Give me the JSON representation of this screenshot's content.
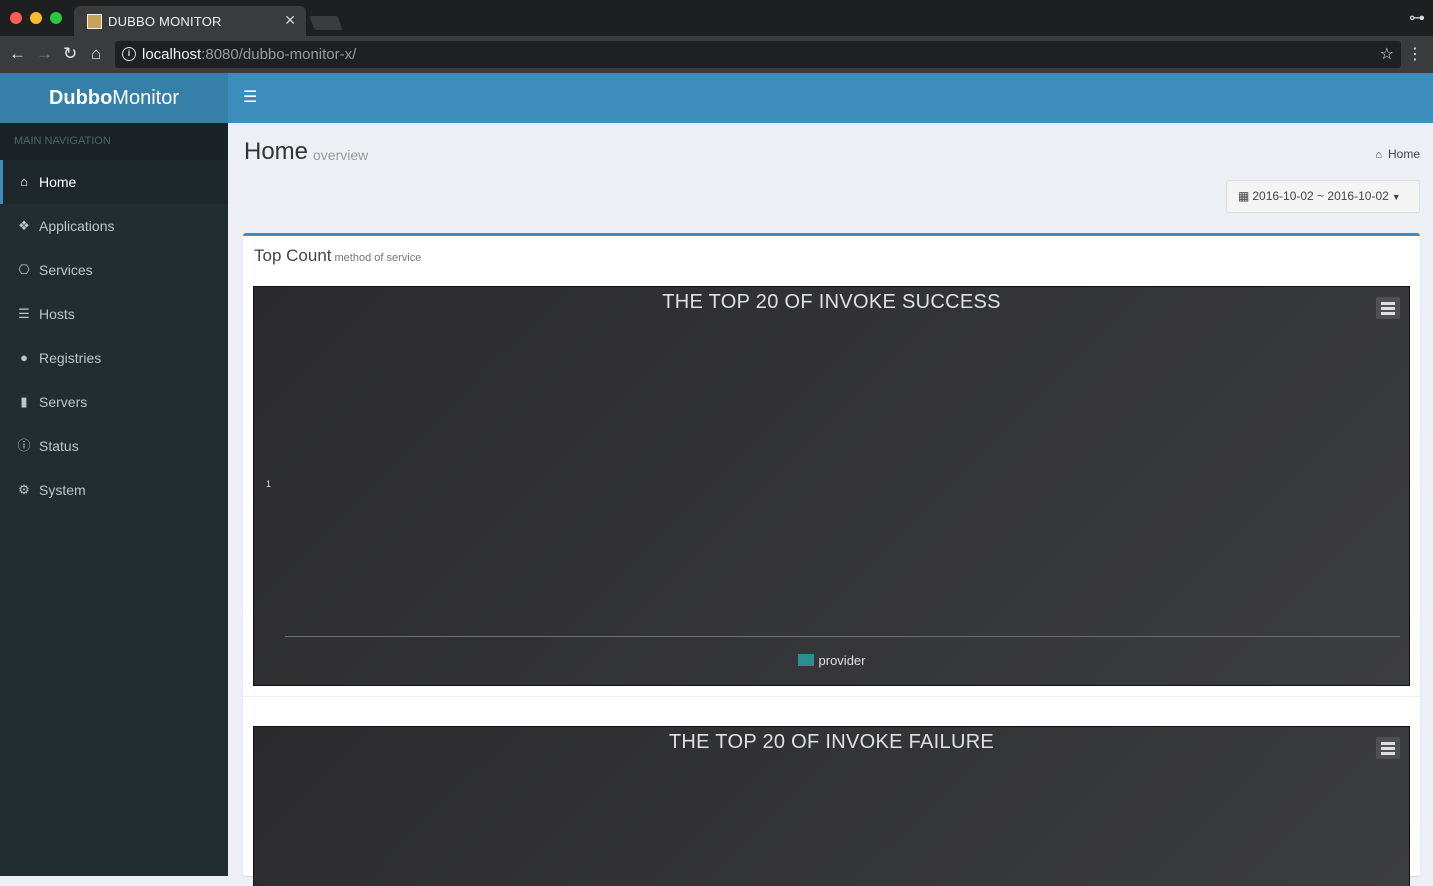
{
  "browser": {
    "tab_title": "DUBBO MONITOR",
    "url_host": "localhost",
    "url_path": ":8080/dubbo-monitor-x/"
  },
  "app": {
    "logo_bold": "Dubbo",
    "logo_light": "Monitor"
  },
  "sidebar": {
    "header": "MAIN NAVIGATION",
    "items": [
      {
        "label": "Home",
        "icon": "home-icon",
        "active": true
      },
      {
        "label": "Applications",
        "icon": "cubes-icon"
      },
      {
        "label": "Services",
        "icon": "services-icon"
      },
      {
        "label": "Hosts",
        "icon": "sliders-icon"
      },
      {
        "label": "Registries",
        "icon": "globe-icon"
      },
      {
        "label": "Servers",
        "icon": "server-icon"
      },
      {
        "label": "Status",
        "icon": "info-icon"
      },
      {
        "label": "System",
        "icon": "gear-icon"
      }
    ]
  },
  "page": {
    "title": "Home",
    "subtitle": "overview",
    "breadcrumb": "Home",
    "date_range": "2016-10-02 ~ 2016-10-02"
  },
  "box": {
    "title": "Top Count",
    "subtitle": "method of service"
  },
  "colors": {
    "header": "#3c8dbc",
    "sidebar": "#222d32",
    "series": "#2b908f"
  },
  "chart_data": [
    {
      "type": "bar",
      "title": "THE TOP 20 OF INVOKE SUCCESS",
      "categories": [],
      "series": [
        {
          "name": "provider",
          "values": []
        }
      ],
      "y_tick_labels": [
        "1"
      ],
      "legend": "bottom"
    },
    {
      "type": "bar",
      "title": "THE TOP 20 OF INVOKE FAILURE",
      "categories": [],
      "series": []
    }
  ]
}
